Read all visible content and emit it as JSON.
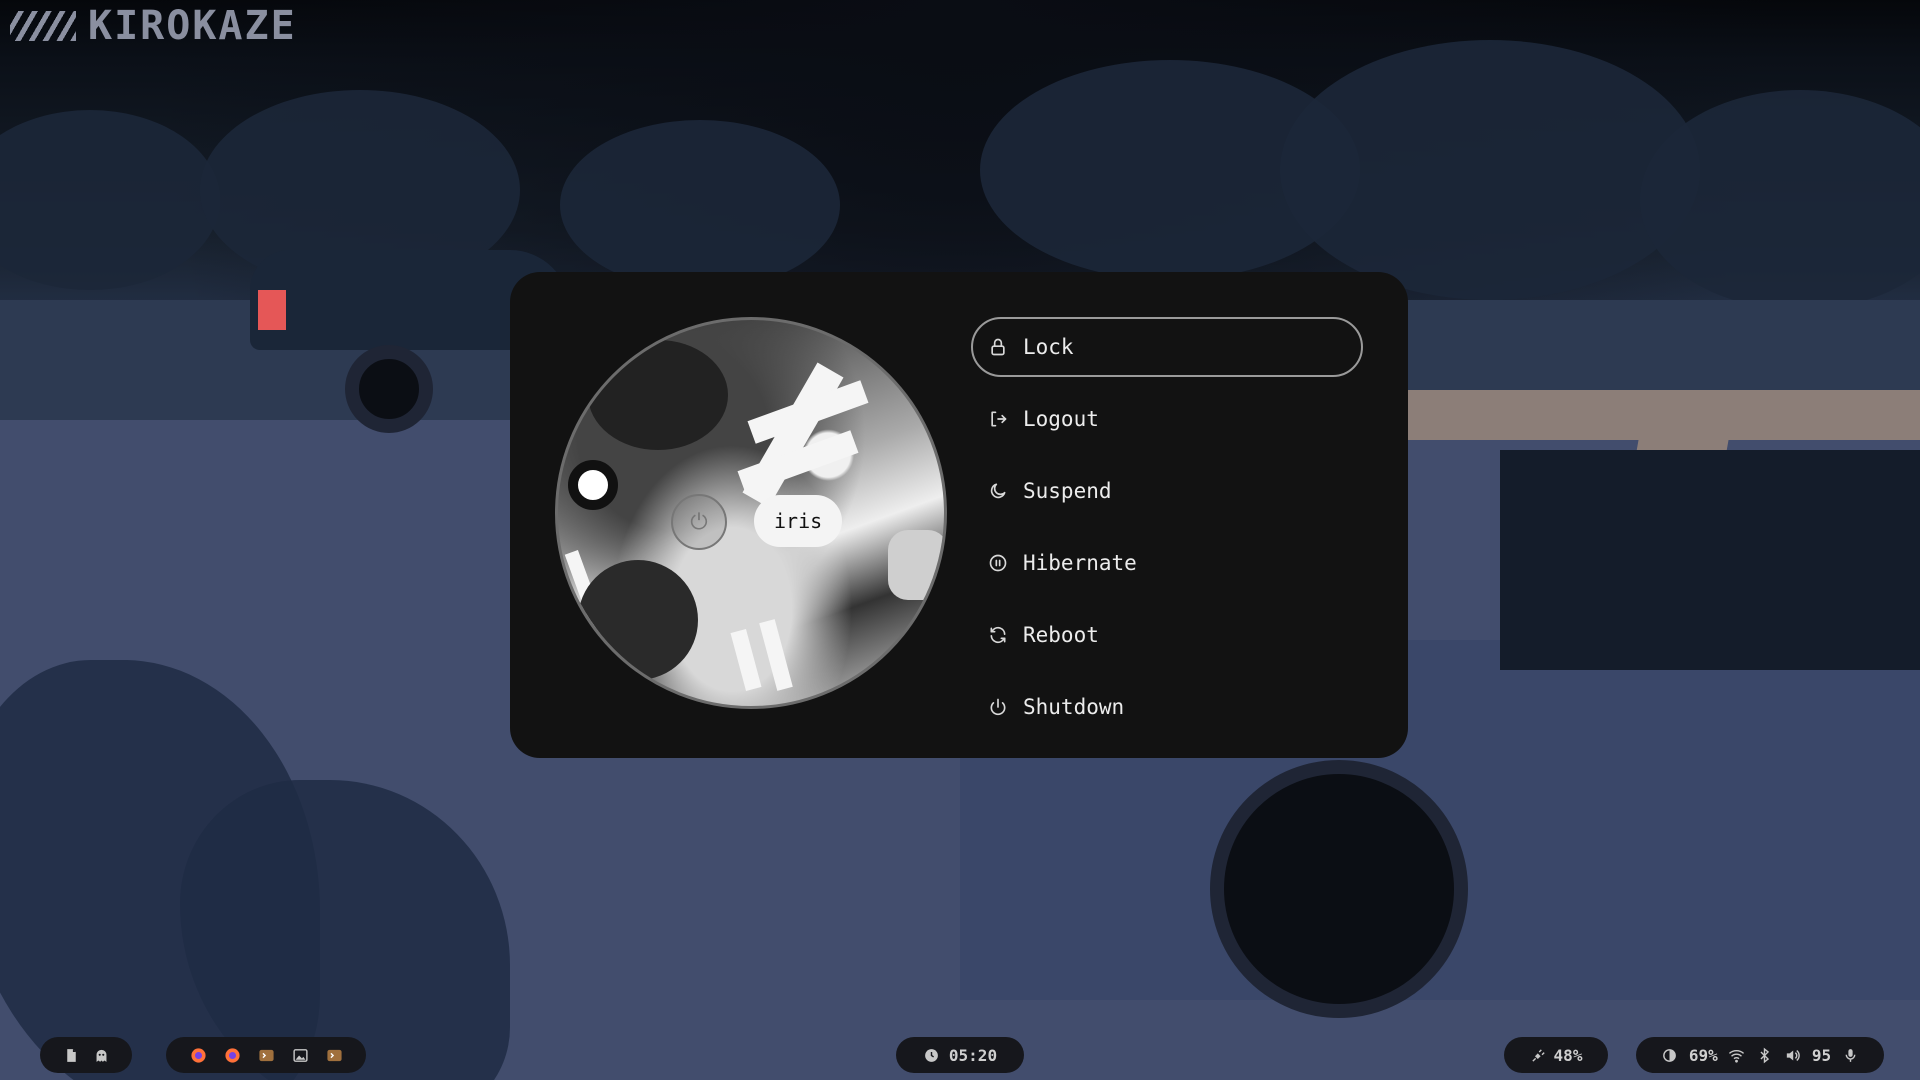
{
  "desktop": {
    "logo_text": "KIROKAZE"
  },
  "power_menu": {
    "username": "iris",
    "items": [
      {
        "label": "Lock",
        "icon": "lock-icon",
        "selected": true
      },
      {
        "label": "Logout",
        "icon": "logout-icon",
        "selected": false
      },
      {
        "label": "Suspend",
        "icon": "moon-icon",
        "selected": false
      },
      {
        "label": "Hibernate",
        "icon": "pause-circle-icon",
        "selected": false
      },
      {
        "label": "Reboot",
        "icon": "refresh-icon",
        "selected": false
      },
      {
        "label": "Shutdown",
        "icon": "power-icon",
        "selected": false
      }
    ]
  },
  "bar": {
    "workspaces": [
      "files-icon",
      "ghost-icon"
    ],
    "apps": [
      "firefox-icon",
      "firefox-icon",
      "terminal-icon",
      "image-viewer-icon",
      "terminal-icon"
    ],
    "clock": "05:20",
    "battery": "48%",
    "brightness": "69%",
    "volume": "95"
  },
  "colors": {
    "panel_bg": "#121212",
    "bar_pill_bg": "#16171c",
    "accent_firefox": "#ff7139"
  }
}
